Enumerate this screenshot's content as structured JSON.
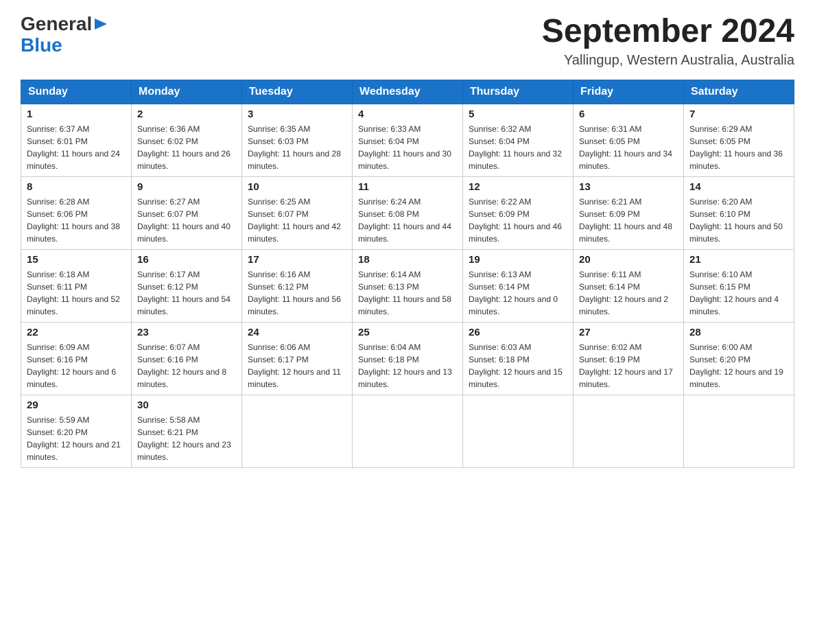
{
  "header": {
    "month_year": "September 2024",
    "location": "Yallingup, Western Australia, Australia",
    "logo_general": "General",
    "logo_blue": "Blue"
  },
  "weekdays": [
    "Sunday",
    "Monday",
    "Tuesday",
    "Wednesday",
    "Thursday",
    "Friday",
    "Saturday"
  ],
  "weeks": [
    [
      {
        "day": 1,
        "sunrise": "6:37 AM",
        "sunset": "6:01 PM",
        "daylight": "11 hours and 24 minutes."
      },
      {
        "day": 2,
        "sunrise": "6:36 AM",
        "sunset": "6:02 PM",
        "daylight": "11 hours and 26 minutes."
      },
      {
        "day": 3,
        "sunrise": "6:35 AM",
        "sunset": "6:03 PM",
        "daylight": "11 hours and 28 minutes."
      },
      {
        "day": 4,
        "sunrise": "6:33 AM",
        "sunset": "6:04 PM",
        "daylight": "11 hours and 30 minutes."
      },
      {
        "day": 5,
        "sunrise": "6:32 AM",
        "sunset": "6:04 PM",
        "daylight": "11 hours and 32 minutes."
      },
      {
        "day": 6,
        "sunrise": "6:31 AM",
        "sunset": "6:05 PM",
        "daylight": "11 hours and 34 minutes."
      },
      {
        "day": 7,
        "sunrise": "6:29 AM",
        "sunset": "6:05 PM",
        "daylight": "11 hours and 36 minutes."
      }
    ],
    [
      {
        "day": 8,
        "sunrise": "6:28 AM",
        "sunset": "6:06 PM",
        "daylight": "11 hours and 38 minutes."
      },
      {
        "day": 9,
        "sunrise": "6:27 AM",
        "sunset": "6:07 PM",
        "daylight": "11 hours and 40 minutes."
      },
      {
        "day": 10,
        "sunrise": "6:25 AM",
        "sunset": "6:07 PM",
        "daylight": "11 hours and 42 minutes."
      },
      {
        "day": 11,
        "sunrise": "6:24 AM",
        "sunset": "6:08 PM",
        "daylight": "11 hours and 44 minutes."
      },
      {
        "day": 12,
        "sunrise": "6:22 AM",
        "sunset": "6:09 PM",
        "daylight": "11 hours and 46 minutes."
      },
      {
        "day": 13,
        "sunrise": "6:21 AM",
        "sunset": "6:09 PM",
        "daylight": "11 hours and 48 minutes."
      },
      {
        "day": 14,
        "sunrise": "6:20 AM",
        "sunset": "6:10 PM",
        "daylight": "11 hours and 50 minutes."
      }
    ],
    [
      {
        "day": 15,
        "sunrise": "6:18 AM",
        "sunset": "6:11 PM",
        "daylight": "11 hours and 52 minutes."
      },
      {
        "day": 16,
        "sunrise": "6:17 AM",
        "sunset": "6:12 PM",
        "daylight": "11 hours and 54 minutes."
      },
      {
        "day": 17,
        "sunrise": "6:16 AM",
        "sunset": "6:12 PM",
        "daylight": "11 hours and 56 minutes."
      },
      {
        "day": 18,
        "sunrise": "6:14 AM",
        "sunset": "6:13 PM",
        "daylight": "11 hours and 58 minutes."
      },
      {
        "day": 19,
        "sunrise": "6:13 AM",
        "sunset": "6:14 PM",
        "daylight": "12 hours and 0 minutes."
      },
      {
        "day": 20,
        "sunrise": "6:11 AM",
        "sunset": "6:14 PM",
        "daylight": "12 hours and 2 minutes."
      },
      {
        "day": 21,
        "sunrise": "6:10 AM",
        "sunset": "6:15 PM",
        "daylight": "12 hours and 4 minutes."
      }
    ],
    [
      {
        "day": 22,
        "sunrise": "6:09 AM",
        "sunset": "6:16 PM",
        "daylight": "12 hours and 6 minutes."
      },
      {
        "day": 23,
        "sunrise": "6:07 AM",
        "sunset": "6:16 PM",
        "daylight": "12 hours and 8 minutes."
      },
      {
        "day": 24,
        "sunrise": "6:06 AM",
        "sunset": "6:17 PM",
        "daylight": "12 hours and 11 minutes."
      },
      {
        "day": 25,
        "sunrise": "6:04 AM",
        "sunset": "6:18 PM",
        "daylight": "12 hours and 13 minutes."
      },
      {
        "day": 26,
        "sunrise": "6:03 AM",
        "sunset": "6:18 PM",
        "daylight": "12 hours and 15 minutes."
      },
      {
        "day": 27,
        "sunrise": "6:02 AM",
        "sunset": "6:19 PM",
        "daylight": "12 hours and 17 minutes."
      },
      {
        "day": 28,
        "sunrise": "6:00 AM",
        "sunset": "6:20 PM",
        "daylight": "12 hours and 19 minutes."
      }
    ],
    [
      {
        "day": 29,
        "sunrise": "5:59 AM",
        "sunset": "6:20 PM",
        "daylight": "12 hours and 21 minutes."
      },
      {
        "day": 30,
        "sunrise": "5:58 AM",
        "sunset": "6:21 PM",
        "daylight": "12 hours and 23 minutes."
      },
      null,
      null,
      null,
      null,
      null
    ]
  ]
}
